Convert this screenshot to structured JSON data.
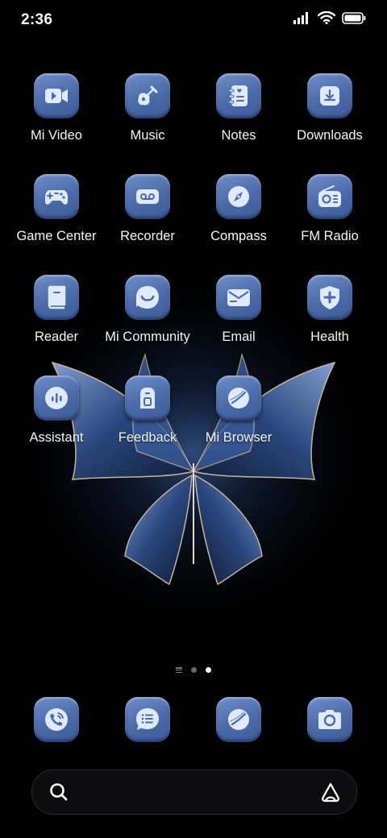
{
  "status": {
    "time": "2:36"
  },
  "apps": [
    {
      "label": "Mi Video",
      "icon": "video-icon"
    },
    {
      "label": "Music",
      "icon": "guitar-icon"
    },
    {
      "label": "Notes",
      "icon": "notes-icon"
    },
    {
      "label": "Downloads",
      "icon": "download-icon"
    },
    {
      "label": "Game Center",
      "icon": "gamepad-icon"
    },
    {
      "label": "Recorder",
      "icon": "recorder-icon"
    },
    {
      "label": "Compass",
      "icon": "compass-icon"
    },
    {
      "label": "FM Radio",
      "icon": "radio-icon"
    },
    {
      "label": "Reader",
      "icon": "book-icon"
    },
    {
      "label": "Mi Community",
      "icon": "community-icon"
    },
    {
      "label": "Email",
      "icon": "email-icon"
    },
    {
      "label": "Health",
      "icon": "health-icon"
    },
    {
      "label": "Assistant",
      "icon": "assistant-icon"
    },
    {
      "label": "Feedback",
      "icon": "feedback-icon"
    },
    {
      "label": "Mi Browser",
      "icon": "browser-icon"
    }
  ],
  "dock": [
    {
      "icon": "phone-icon"
    },
    {
      "icon": "messages-icon"
    },
    {
      "icon": "browser-icon"
    },
    {
      "icon": "camera-icon"
    }
  ],
  "pages": {
    "count": 2,
    "current": 2
  },
  "colors": {
    "icon_bg": "#4a6aa8",
    "icon_glyph": "#dfe9ff",
    "background": "#000000"
  }
}
